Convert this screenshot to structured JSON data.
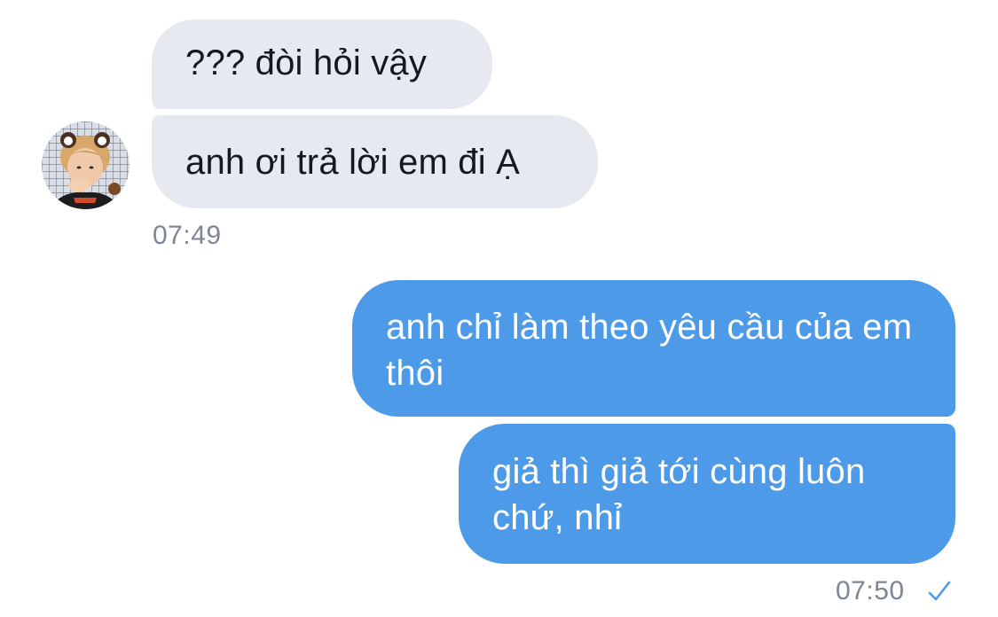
{
  "incoming": {
    "messages": [
      "??? đòi hỏi vậy",
      "anh ơi trả lời em đi Ạ"
    ],
    "time": "07:49"
  },
  "outgoing": {
    "messages": [
      "anh chỉ làm theo yêu cầu của em thôi",
      "giả thì giả tới cùng luôn chứ, nhỉ"
    ],
    "time": "07:50",
    "status_icon": "check-icon"
  },
  "colors": {
    "incoming_bubble": "#e6e9ef",
    "outgoing_bubble": "#4d9be8",
    "timestamp": "#7d8695",
    "check": "#4d9be8"
  },
  "avatar_icon": "contact-avatar"
}
